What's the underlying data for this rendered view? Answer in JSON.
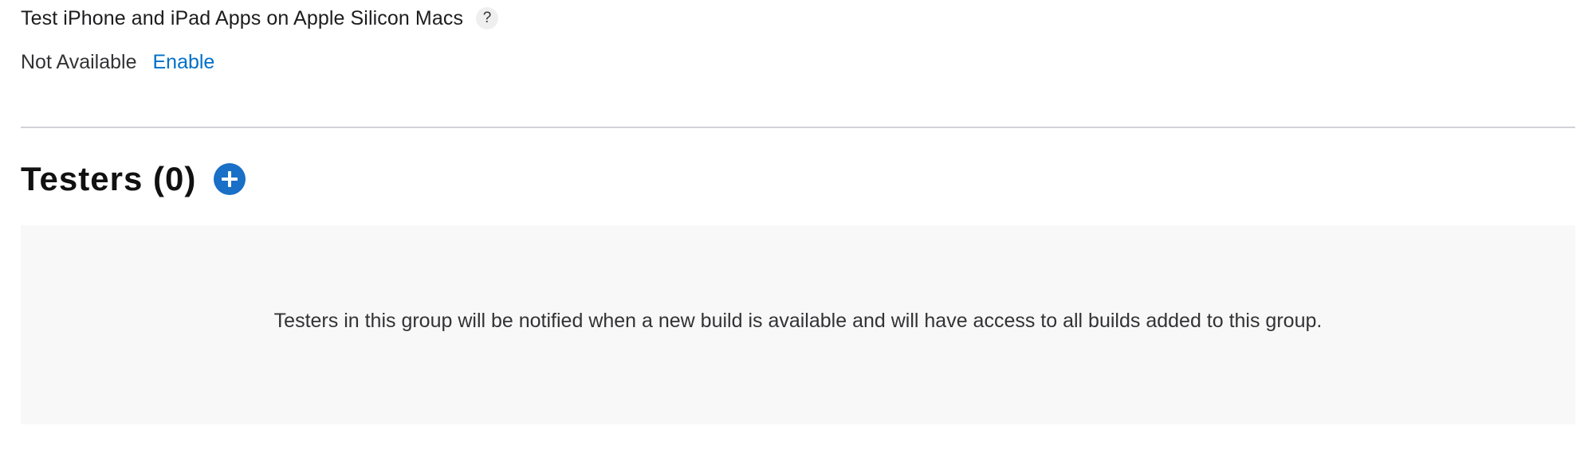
{
  "apple_silicon": {
    "title": "Test iPhone and iPad Apps on Apple Silicon Macs",
    "help_label": "?",
    "status": "Not Available",
    "enable_label": "Enable"
  },
  "testers": {
    "title": "Testers (0)",
    "add_icon": "plus-circle-icon",
    "empty_message": "Testers in this group will be notified when a new build is available and will have access to all builds added to this group."
  },
  "colors": {
    "accent": "#0070c9",
    "add_button": "#1a6fc6",
    "panel_background": "#f8f8f8",
    "divider": "#d2d2d7"
  }
}
